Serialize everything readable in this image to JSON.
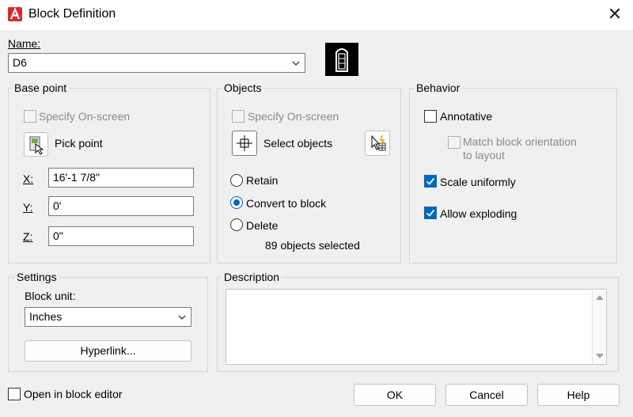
{
  "window": {
    "title": "Block Definition",
    "close_glyph": "✕"
  },
  "name": {
    "label": "Name:",
    "value": "D6"
  },
  "base_point": {
    "title": "Base point",
    "specify_onscreen": "Specify On-screen",
    "pick_point": "Pick point",
    "x_label": "X:",
    "x_value": "16'-1 7/8\"",
    "y_label": "Y:",
    "y_value": "0'",
    "z_label": "Z:",
    "z_value": "0\""
  },
  "objects": {
    "title": "Objects",
    "specify_onscreen": "Specify On-screen",
    "select_objects": "Select objects",
    "retain": "Retain",
    "convert": "Convert to block",
    "delete": "Delete",
    "selected_count": "89 objects selected"
  },
  "behavior": {
    "title": "Behavior",
    "annotative": "Annotative",
    "match_line1": "Match block orientation",
    "match_line2": "to layout",
    "scale_uniformly": "Scale uniformly",
    "allow_exploding": "Allow exploding"
  },
  "settings": {
    "title": "Settings",
    "block_unit_label": "Block unit:",
    "block_unit_value": "Inches",
    "hyperlink": "Hyperlink..."
  },
  "description": {
    "title": "Description",
    "value": ""
  },
  "footer": {
    "open_in_editor": "Open in block editor",
    "ok": "OK",
    "cancel": "Cancel",
    "help": "Help"
  },
  "colors": {
    "accent": "#0067c0",
    "app_icon": "#d92b2b"
  },
  "icons": {
    "app": "autocad-app-icon",
    "pick_point": "pick-point-icon",
    "select_objects": "select-objects-icon",
    "quick_select": "quick-select-icon",
    "preview": "block-preview-icon"
  }
}
